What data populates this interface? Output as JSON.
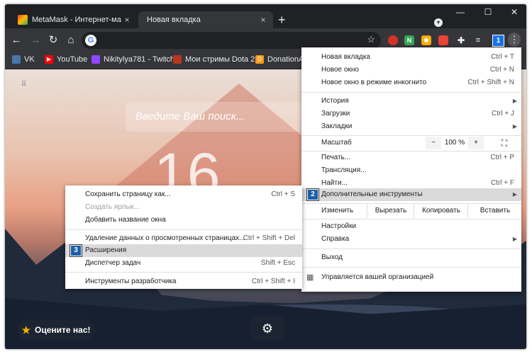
{
  "tabs": [
    {
      "title": "MetaMask - Интернет-магазин (",
      "close": "×",
      "state": "inactive"
    },
    {
      "title": "Новая вкладка",
      "close": "×",
      "state": "active"
    }
  ],
  "tabstrip": {
    "new_tab": "+",
    "minimize": "—",
    "maximize": "☐",
    "close": "✕"
  },
  "toolbar": {
    "back": "←",
    "forward": "→",
    "reload": "↻",
    "home": "⌂",
    "omnibox_icon": "G",
    "bookmark_star": "☆",
    "ext_badge": "1",
    "menu": "⋮"
  },
  "bookmarks": [
    {
      "label": "VK",
      "icon": "vk-icon",
      "color": "#ffffff"
    },
    {
      "label": "YouTube",
      "icon": "youtube-icon",
      "color": "#ff0000"
    },
    {
      "label": "Nikitylya781 - Twitch",
      "icon": "twitch-icon",
      "color": "#9146ff"
    },
    {
      "label": "Мои стримы Dota 2",
      "icon": "dota-icon",
      "color": "#b8371e"
    },
    {
      "label": "DonationAle",
      "icon": "donationalerts-icon",
      "color": "#f59c1a"
    }
  ],
  "page": {
    "search_placeholder": "Введите Ваш поиск...",
    "clock": "16",
    "rate_button": "Оцените нас!"
  },
  "chrome_menu": {
    "items_top": [
      {
        "label": "Новая вкладка",
        "shortcut": "Ctrl + T"
      },
      {
        "label": "Новое окно",
        "shortcut": "Ctrl + N"
      },
      {
        "label": "Новое окно в режиме инкогнито",
        "shortcut": "Ctrl + Shift + N"
      }
    ],
    "items_history": [
      {
        "label": "История",
        "shortcut": ""
      },
      {
        "label": "Загрузки",
        "shortcut": "Ctrl + J"
      },
      {
        "label": "Закладки",
        "shortcut": ""
      }
    ],
    "zoom": {
      "label": "Масштаб",
      "minus": "−",
      "value": "100 %",
      "plus": "+",
      "fullscreen": "⛶"
    },
    "items_print": [
      {
        "label": "Печать...",
        "shortcut": "Ctrl + P"
      },
      {
        "label": "Трансляция...",
        "shortcut": ""
      },
      {
        "label": "Найти...",
        "shortcut": "Ctrl + F"
      },
      {
        "label": "Дополнительные инструменты",
        "shortcut": ""
      }
    ],
    "edit": {
      "label": "Изменить",
      "cut": "Вырезать",
      "copy": "Копировать",
      "paste": "Вставить"
    },
    "items_bottom": [
      {
        "label": "Настройки",
        "shortcut": ""
      },
      {
        "label": "Справка",
        "shortcut": ""
      },
      {
        "label": "Выход",
        "shortcut": ""
      }
    ],
    "managed": "Управляется вашей организацией",
    "step_badge": "2"
  },
  "tools_menu": {
    "items": [
      {
        "label": "Сохранить страницу как...",
        "shortcut": "Ctrl + S"
      },
      {
        "label": "Создать ярлык...",
        "shortcut": ""
      },
      {
        "label": "Добавить название окна",
        "shortcut": ""
      },
      {
        "label": "Удаление данных о просмотренных страницах...",
        "shortcut": "Ctrl + Shift + Del"
      },
      {
        "label": "Расширения",
        "shortcut": ""
      },
      {
        "label": "Диспетчер задач",
        "shortcut": "Shift + Esc"
      },
      {
        "label": "Инструменты разработчика",
        "shortcut": "Ctrl + Shift + I"
      }
    ],
    "step_badge": "3"
  }
}
